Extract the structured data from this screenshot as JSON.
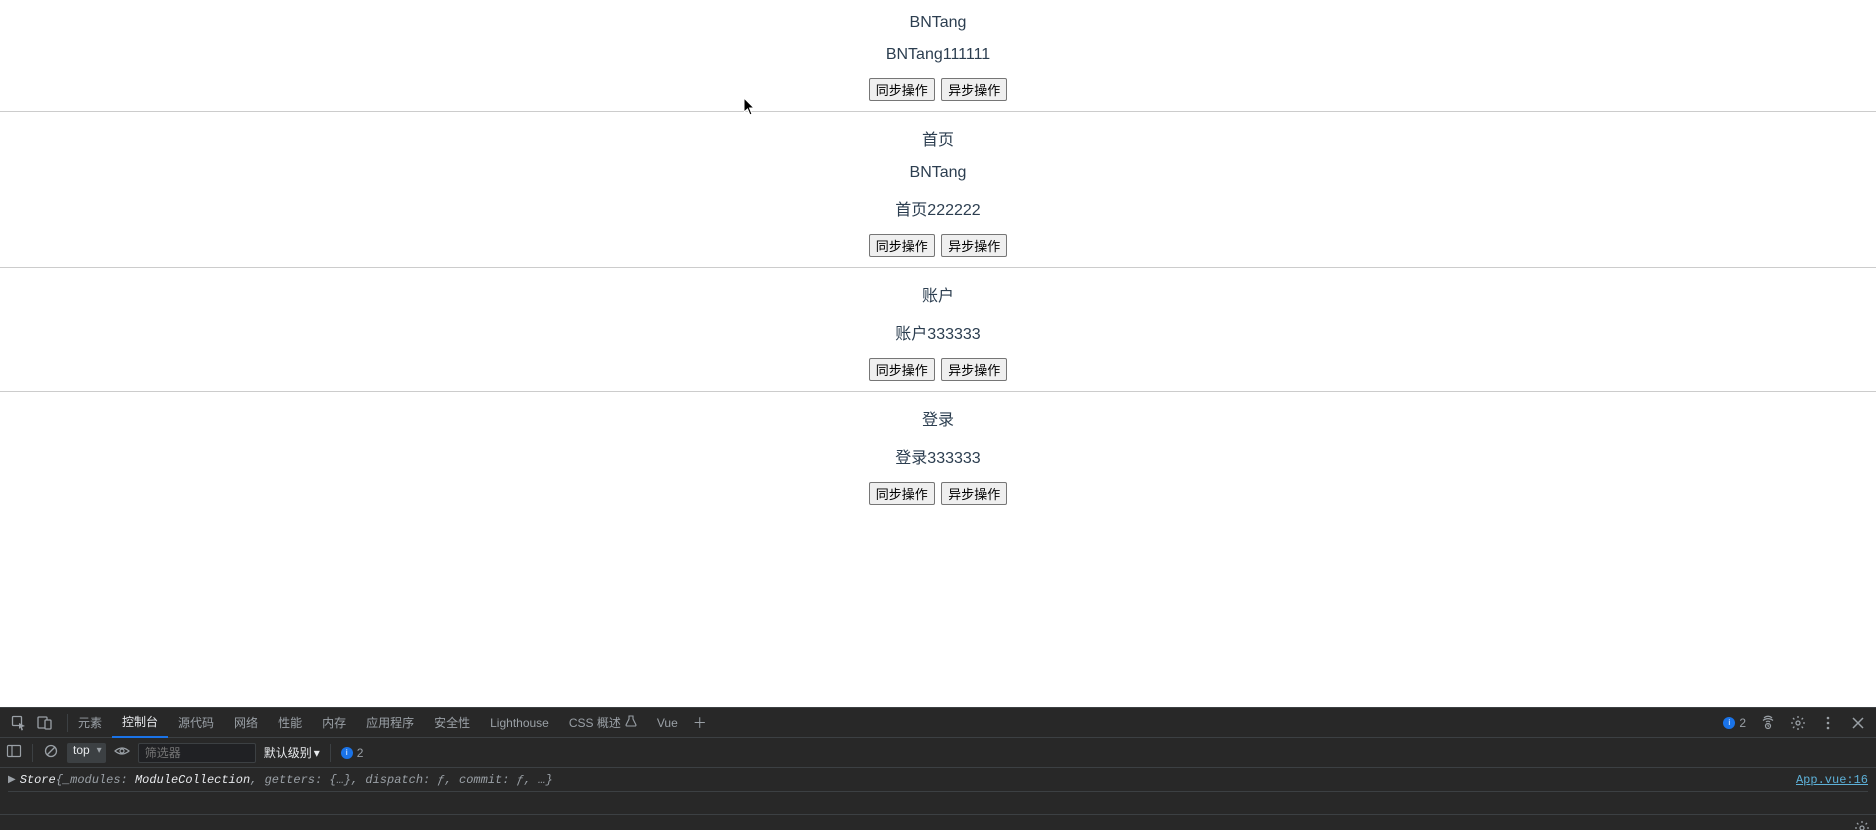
{
  "sections": [
    {
      "lines": [
        "BNTang",
        "BNTang111111"
      ],
      "buttons": [
        "同步操作",
        "异步操作"
      ]
    },
    {
      "lines": [
        "首页",
        "BNTang",
        "首页222222"
      ],
      "buttons": [
        "同步操作",
        "异步操作"
      ]
    },
    {
      "lines": [
        "账户",
        "账户333333"
      ],
      "buttons": [
        "同步操作",
        "异步操作"
      ]
    },
    {
      "lines": [
        "登录",
        "登录333333"
      ],
      "buttons": [
        "同步操作",
        "异步操作"
      ]
    }
  ],
  "devtools": {
    "tabs": [
      "元素",
      "控制台",
      "源代码",
      "网络",
      "性能",
      "内存",
      "应用程序",
      "安全性",
      "Lighthouse",
      "CSS 概述",
      "Vue"
    ],
    "active_tab": "控制台",
    "badge_tab": "CSS 概述",
    "header_issue_count": "2",
    "toolbar": {
      "context": "top",
      "filter_placeholder": "筛选器",
      "level_label": "默认级别",
      "issue_count": "2"
    },
    "console": {
      "prefix": "Store ",
      "open": "{",
      "kv": [
        {
          "k": "_modules",
          "v": "ModuleCollection"
        },
        {
          "k": "getters",
          "v": "{…}"
        },
        {
          "k": "dispatch",
          "v": "ƒ"
        },
        {
          "k": "commit",
          "v": "ƒ"
        }
      ],
      "ellipsis": ", …",
      "close": "}",
      "src": "App.vue:16"
    }
  }
}
